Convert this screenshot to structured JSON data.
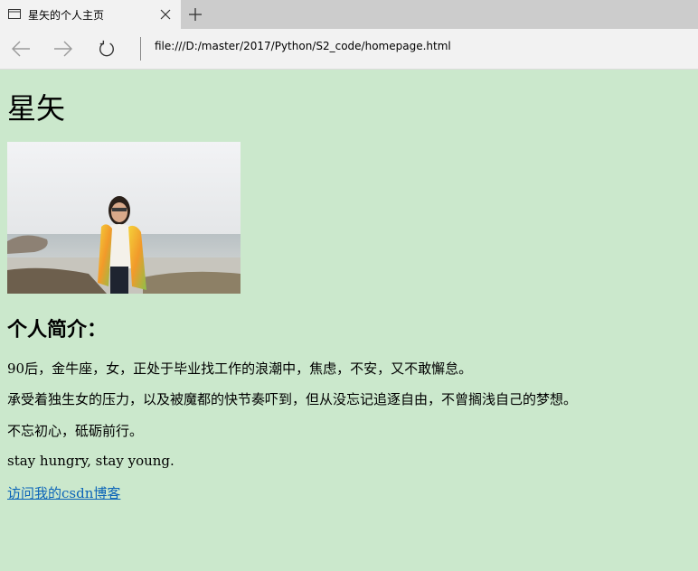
{
  "browser": {
    "tab": {
      "title": "星矢的个人主页"
    },
    "address_bar": {
      "url": "file:///D:/master/2017/Python/S2_code/homepage.html"
    }
  },
  "page": {
    "heading": "星矢",
    "intro_heading": "个人简介：",
    "paragraphs": [
      "90后，金牛座，女，正处于毕业找工作的浪潮中，焦虑，不安，又不敢懈怠。",
      "承受着独生女的压力，以及被魔都的快节奏吓到，但从没忘记追逐自由，不曾搁浅自己的梦想。",
      "不忘初心，砥砺前行。",
      "stay hungry, stay young."
    ],
    "link_text": "访问我的csdn博客"
  },
  "colors": {
    "page_background": "#cbe8cc",
    "link": "#0a63b8"
  }
}
